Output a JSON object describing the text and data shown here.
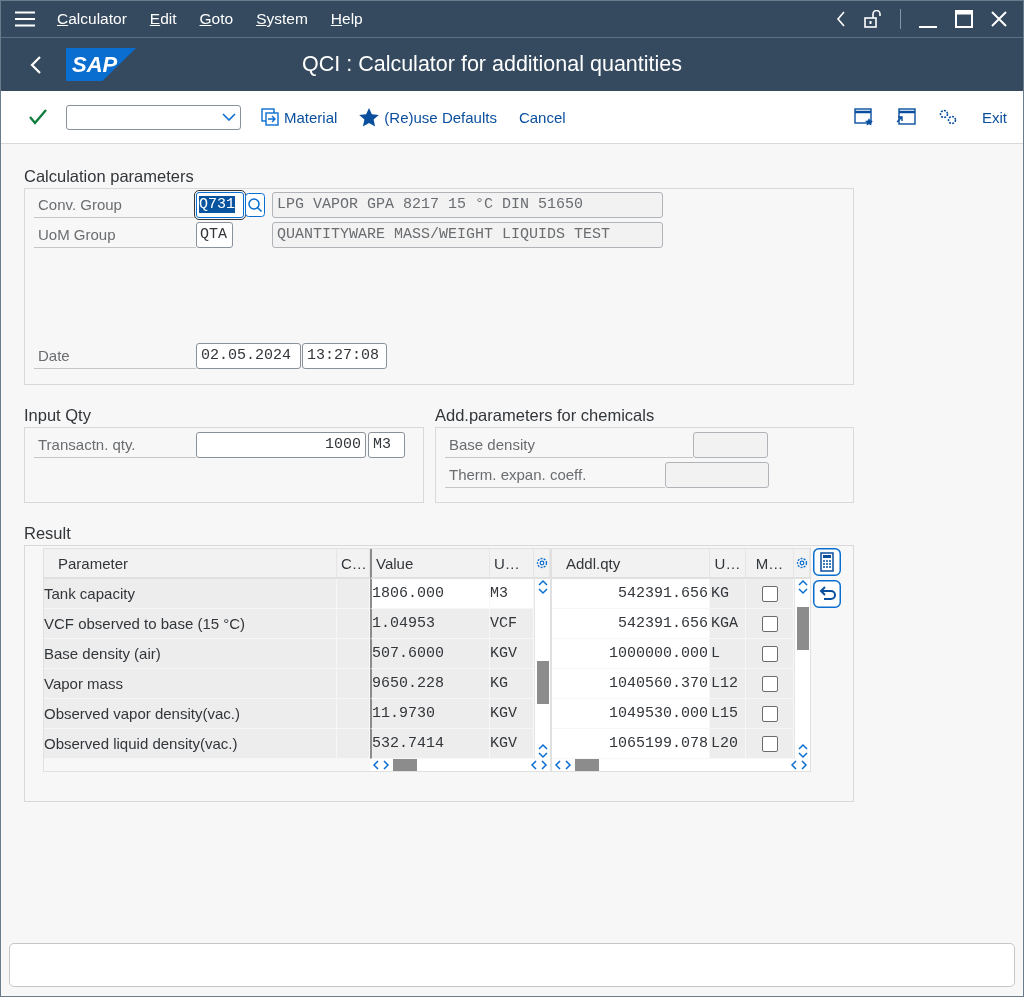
{
  "menu_bar": {
    "items": [
      "Calculator",
      "Edit",
      "Goto",
      "System",
      "Help"
    ]
  },
  "title_bar": {
    "logo": "SAP",
    "title": "QCI : Calculator for additional quantities"
  },
  "toolbar": {
    "buttons": [
      {
        "kind": "material",
        "label": "Material"
      },
      {
        "kind": "defaults",
        "label": "(Re)use Defaults"
      },
      {
        "kind": "plain",
        "label": "Cancel"
      }
    ],
    "exit": "Exit"
  },
  "calculation_parameters": {
    "title": "Calculation parameters",
    "conv_group": {
      "label": "Conv. Group",
      "value": "Q731",
      "focused": true,
      "description": "LPG VAPOR GPA 8217 15 °C DIN 51650"
    },
    "uom_group": {
      "label": "UoM Group",
      "value": "QTA",
      "focused": false,
      "description": "QUANTITYWARE MASS/WEIGHT LIQUIDS TEST"
    },
    "date": {
      "label": "Date",
      "date": "02.05.2024",
      "time": "13:27:08"
    }
  },
  "input_qty": {
    "title": "Input Qty",
    "label": "Transactn. qty.",
    "value": "1000",
    "unit": "M3"
  },
  "chemicals": {
    "title": "Add.parameters for chemicals",
    "fields": [
      {
        "label": "Base density",
        "disabled": true
      },
      {
        "label": "Therm. expan. coeff.",
        "disabled": true
      }
    ]
  },
  "result": {
    "title": "Result",
    "left_columns": [
      "Parameter",
      "C…",
      "Value",
      "U…"
    ],
    "left_rows": [
      {
        "parameter": "Tank capacity",
        "value": "1806.000",
        "unit": "M3",
        "editable": true
      },
      {
        "parameter": "VCF observed to base (15 °C)",
        "value": "1.04953",
        "unit": "VCF",
        "editable": false
      },
      {
        "parameter": "Base density (air)",
        "value": "507.6000",
        "unit": "KGV",
        "editable": false
      },
      {
        "parameter": "Vapor mass",
        "value": "9650.228",
        "unit": "KG",
        "editable": false
      },
      {
        "parameter": "Observed  vapor density(vac.)",
        "value": "11.9730",
        "unit": "KGV",
        "editable": false
      },
      {
        "parameter": "Observed liquid density(vac.)",
        "value": "532.7414",
        "unit": "KGV",
        "editable": false
      }
    ],
    "right_columns": [
      "Addl.qty",
      "U…",
      "M…"
    ],
    "right_rows": [
      {
        "qty": "542391.656",
        "unit": "KG",
        "checked": false
      },
      {
        "qty": "542391.656",
        "unit": "KGA",
        "checked": false
      },
      {
        "qty": "1000000.000",
        "unit": "L",
        "checked": false
      },
      {
        "qty": "1040560.370",
        "unit": "L12",
        "checked": false
      },
      {
        "qty": "1049530.000",
        "unit": "L15",
        "checked": false
      },
      {
        "qty": "1065199.078",
        "unit": "L20",
        "checked": false
      }
    ]
  }
}
